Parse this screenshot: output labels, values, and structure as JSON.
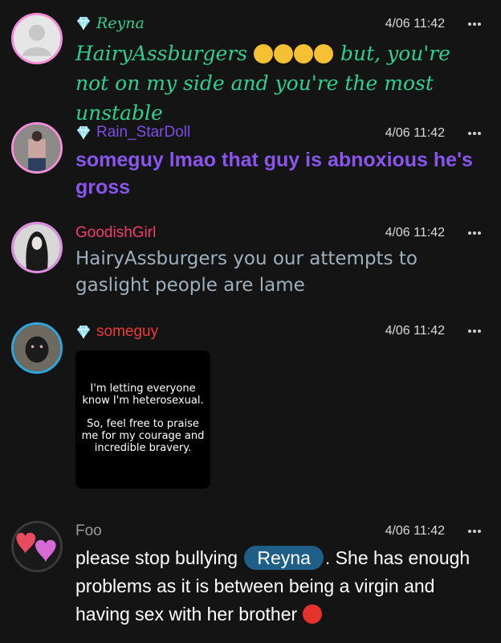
{
  "messages": [
    {
      "username": "Reyna",
      "verified": true,
      "name_color": "#2fcf8f",
      "timestamp": "4/06 11:42",
      "mention": "HairyAssburgers",
      "emojis": [
        "loudly-crying-face",
        "loudly-crying-face",
        "loudly-crying-face",
        "loudly-crying-face"
      ],
      "text_after": "but, you're not on my side and you're the most unstable",
      "text_color": "#2fcf8f"
    },
    {
      "username": "Rain_StarDoll",
      "verified": true,
      "name_color": "#7b4fe6",
      "timestamp": "4/06 11:42",
      "text": "someguy lmao that guy is abnoxious he's gross",
      "text_color": "#8a55ee"
    },
    {
      "username": "GoodishGirl",
      "verified": false,
      "name_color": "#ef3f6b",
      "timestamp": "4/06 11:42",
      "text": "HairyAssburgers you our attempts to gaslight people are lame",
      "text_color": "#9fb0bd"
    },
    {
      "username": "someguy",
      "verified": true,
      "name_color": "#ef3a3a",
      "timestamp": "4/06 11:42",
      "image_text_1": "I'm letting everyone know I'm heterosexual.",
      "image_text_2": "So, feel free to praise me for my courage and incredible bravery."
    },
    {
      "username": "Foo",
      "verified": false,
      "name_color": "#9a9a9a",
      "timestamp": "4/06 11:42",
      "text_before": "please stop bullying",
      "mention": "Reyna",
      "text_after": ". She has enough problems as it is between being a virgin and having sex with her brother",
      "emoji": "angry-face",
      "text_color": "#ffffff"
    }
  ],
  "colors": {
    "background": "#141414",
    "gem": "#8fdcf0",
    "mention_pill": "#1f5f87"
  }
}
